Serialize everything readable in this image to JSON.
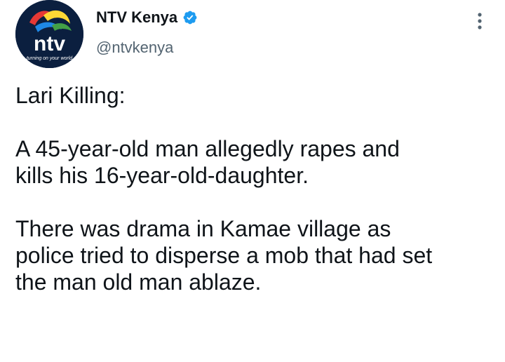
{
  "account": {
    "display_name": "NTV Kenya",
    "handle": "@ntvkenya",
    "verified": true,
    "verified_color": "#1d9bf0",
    "avatar_logo_text": "ntv",
    "avatar_tagline": "turning on your world",
    "avatar_icon": "ntv-logo-icon",
    "verified_icon": "verified-badge-icon",
    "more_icon": "more-vertical-icon"
  },
  "tweet": {
    "paragraphs": [
      "Lari Killing:",
      "A 45-year-old man allegedly rapes and\nkills his 16-year-old-daughter.",
      "There was drama in Kamae village as\npolice tried to disperse a mob that had set\nthe man old man ablaze."
    ]
  },
  "colors": {
    "text_primary": "#0f1419",
    "text_secondary": "#536471",
    "avatar_bg": "#0b1f3f"
  }
}
